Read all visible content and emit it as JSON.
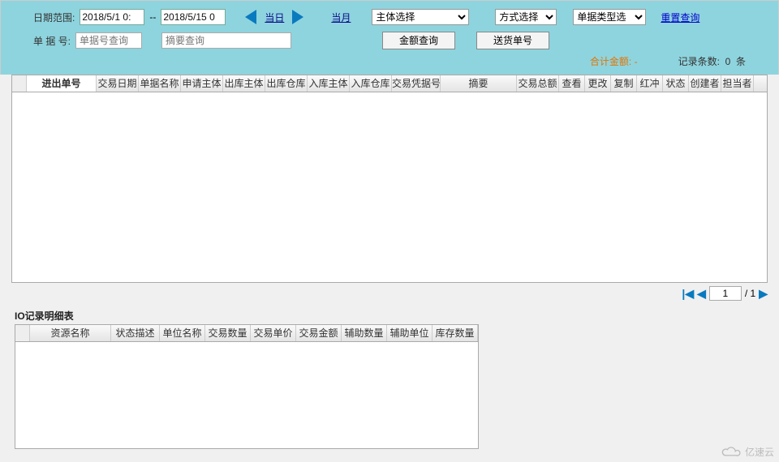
{
  "toolbar": {
    "date_range_label": "日期范围:",
    "date_from": "2018/5/1 0:",
    "date_sep": "--",
    "date_to": "2018/5/15 0",
    "today": "当日",
    "month": "当月",
    "subject_select": "主体选择",
    "mode_select": "方式选择",
    "bill_type_select": "单据类型选",
    "reset_query": "重置查询",
    "bill_no_label": "单  据  号:",
    "bill_no_ph": "单据号查询",
    "summary_ph": "摘要查询",
    "amount_query": "金额查询",
    "delivery_no": "送货单号"
  },
  "summary": {
    "total_label": "合计金额:",
    "total_value": "-",
    "count_label": "记录条数:",
    "count_value": "0",
    "count_unit": "条"
  },
  "grid": {
    "cols": [
      "",
      "进出单号",
      "交易日期",
      "单据名称",
      "申请主体",
      "出库主体",
      "出库仓库",
      "入库主体",
      "入库仓库",
      "交易凭据号",
      "摘要",
      "交易总额",
      "查看",
      "更改",
      "复制",
      "红冲",
      "状态",
      "创建者",
      "担当者"
    ]
  },
  "pager": {
    "first": "|◀",
    "prev": "◀",
    "page": "1",
    "total": "/ 1",
    "next": "▶"
  },
  "detail": {
    "title": "IO记录明细表",
    "cols": [
      "",
      "资源名称",
      "状态描述",
      "单位名称",
      "交易数量",
      "交易单价",
      "交易金额",
      "辅助数量",
      "辅助单位",
      "库存数量"
    ]
  },
  "watermark": "亿速云"
}
